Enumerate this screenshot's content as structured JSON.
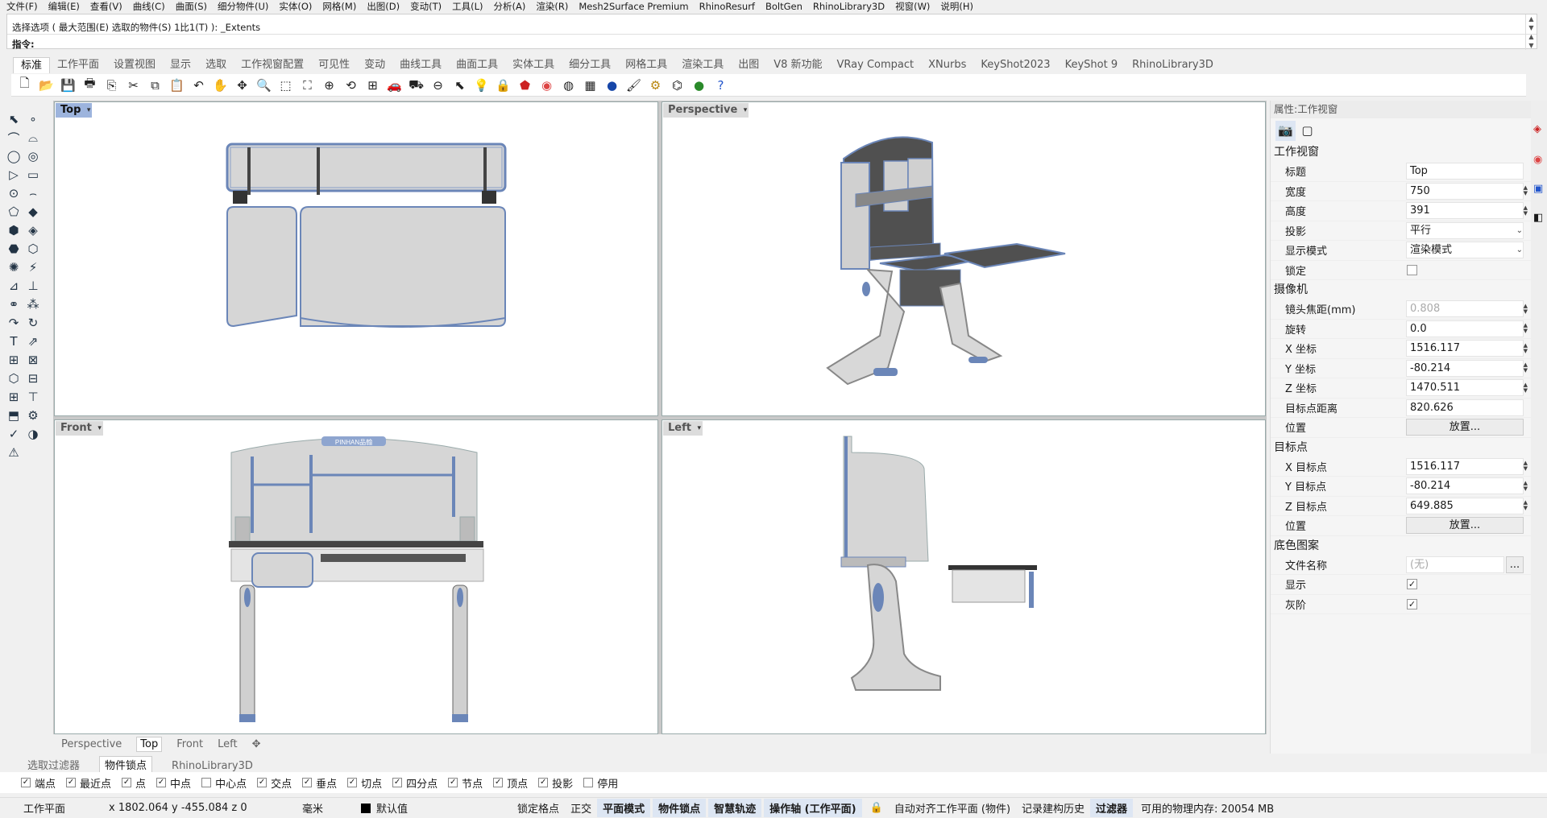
{
  "menu": [
    "文件(F)",
    "编辑(E)",
    "查看(V)",
    "曲线(C)",
    "曲面(S)",
    "细分物件(U)",
    "实体(O)",
    "网格(M)",
    "出图(D)",
    "变动(T)",
    "工具(L)",
    "分析(A)",
    "渲染(R)",
    "Mesh2Surface Premium",
    "RhinoResurf",
    "BoltGen",
    "RhinoLibrary3D",
    "视窗(W)",
    "说明(H)"
  ],
  "command": {
    "history": "选择选项 ( 最大范围(E)  选取的物件(S)  1比1(T) ): _Extents",
    "prompt": "指令:"
  },
  "tabs": [
    "标准",
    "工作平面",
    "设置视图",
    "显示",
    "选取",
    "工作视窗配置",
    "可见性",
    "变动",
    "曲线工具",
    "曲面工具",
    "实体工具",
    "细分工具",
    "网格工具",
    "渲染工具",
    "出图",
    "V8 新功能",
    "VRay Compact",
    "XNurbs",
    "KeyShot2023",
    "KeyShot 9",
    "RhinoLibrary3D"
  ],
  "viewports": {
    "top": "Top",
    "perspective": "Perspective",
    "front": "Front",
    "left": "Left",
    "watermark": "PINHAN品翰"
  },
  "viewport_tabs": [
    "Perspective",
    "Top",
    "Front",
    "Left"
  ],
  "props": {
    "header": "属性:工作视窗",
    "viewport_section": "工作视窗",
    "camera_section": "摄像机",
    "target_section": "目标点",
    "wallpaper_section": "底色图案",
    "rows": {
      "title": {
        "label": "标题",
        "value": "Top"
      },
      "width": {
        "label": "宽度",
        "value": "750"
      },
      "height": {
        "label": "高度",
        "value": "391"
      },
      "projection": {
        "label": "投影",
        "value": "平行"
      },
      "display_mode": {
        "label": "显示模式",
        "value": "渲染模式"
      },
      "lock": {
        "label": "锁定"
      },
      "focal": {
        "label": "镜头焦距(mm)",
        "value": "0.808"
      },
      "rotation": {
        "label": "旋转",
        "value": "0.0"
      },
      "cam_x": {
        "label": "X 坐标",
        "value": "1516.117"
      },
      "cam_y": {
        "label": "Y 坐标",
        "value": "-80.214"
      },
      "cam_z": {
        "label": "Z 坐标",
        "value": "1470.511"
      },
      "target_dist": {
        "label": "目标点距离",
        "value": "820.626"
      },
      "cam_pos": {
        "label": "位置",
        "value": "放置..."
      },
      "tgt_x": {
        "label": "X 目标点",
        "value": "1516.117"
      },
      "tgt_y": {
        "label": "Y 目标点",
        "value": "-80.214"
      },
      "tgt_z": {
        "label": "Z 目标点",
        "value": "649.885"
      },
      "tgt_pos": {
        "label": "位置",
        "value": "放置..."
      },
      "filename": {
        "label": "文件名称",
        "value": "(无)"
      },
      "show": {
        "label": "显示"
      },
      "gray": {
        "label": "灰阶"
      }
    },
    "browse": "..."
  },
  "osnap_tabs": [
    "选取过滤器",
    "物件锁点",
    "RhinoLibrary3D"
  ],
  "osnap_side": "物件",
  "osnaps": [
    {
      "label": "端点",
      "on": true
    },
    {
      "label": "最近点",
      "on": true
    },
    {
      "label": "点",
      "on": true
    },
    {
      "label": "中点",
      "on": true
    },
    {
      "label": "中心点",
      "on": false
    },
    {
      "label": "交点",
      "on": true
    },
    {
      "label": "垂点",
      "on": true
    },
    {
      "label": "切点",
      "on": true
    },
    {
      "label": "四分点",
      "on": true
    },
    {
      "label": "节点",
      "on": true
    },
    {
      "label": "顶点",
      "on": true
    },
    {
      "label": "投影",
      "on": true
    },
    {
      "label": "停用",
      "on": false
    }
  ],
  "status": {
    "cplane": "工作平面",
    "coords": "x 1802.064  y -455.084  z 0",
    "units": "毫米",
    "layer": "默认值",
    "grid_snap": "锁定格点",
    "ortho": "正交",
    "planar": "平面模式",
    "osnap": "物件锁点",
    "smarttrack": "智慧轨迹",
    "gumball": "操作轴 (工作平面)",
    "autoalign": "自动对齐工作平面 (物件)",
    "history": "记录建构历史",
    "filter": "过滤器",
    "memory": "可用的物理内存: 20054 MB"
  },
  "colors": {
    "accent": "#9db4dd",
    "model_fill": "#d6d6d6",
    "model_edge": "#6b86b8",
    "dark": "#505050"
  }
}
